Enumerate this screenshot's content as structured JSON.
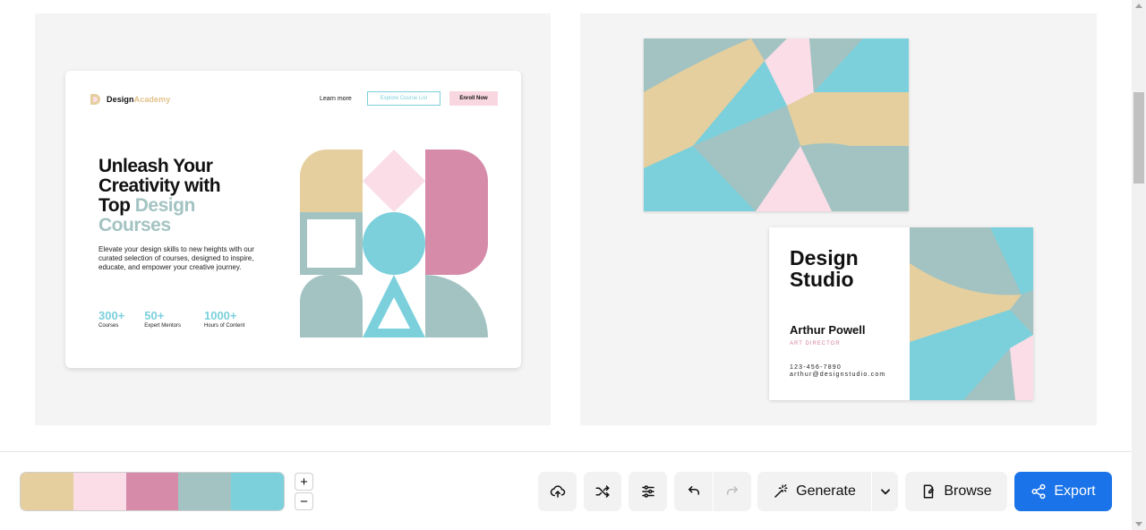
{
  "landing_page": {
    "logo_primary": "Design",
    "logo_accent": "Academy",
    "nav_learn_more": "Learn more",
    "nav_explore": "Explore Course List",
    "nav_enroll": "Enroll Now",
    "hero_line1": "Unleash Your",
    "hero_line2": "Creativity with",
    "hero_line3_dark": "Top ",
    "hero_line3_muted": "Design",
    "hero_line4_muted": "Courses",
    "description": "Elevate your design skills to new heights with our curated selection of courses, designed to inspire, educate, and empower your creative journey.",
    "stats": [
      {
        "value": "300+",
        "label": "Courses"
      },
      {
        "value": "50+",
        "label": "Expert Mentors"
      },
      {
        "value": "1000+",
        "label": "Hours of Content"
      }
    ]
  },
  "business_card": {
    "title_line1": "Design",
    "title_line2": "Studio",
    "name": "Arthur Powell",
    "role": "ART DIRECTOR",
    "phone": "123-456-7890",
    "email": "arthur@designstudio.com"
  },
  "palette": {
    "colors": [
      "#e5cf9e",
      "#fadde7",
      "#d68ba9",
      "#a3c3c2",
      "#7bd0dc"
    ]
  },
  "zoom": {
    "plus": "+",
    "minus": "−"
  },
  "toolbar": {
    "upload_icon": "cloud-upload-icon",
    "shuffle_icon": "shuffle-icon",
    "adjust_icon": "sliders-icon",
    "undo_icon": "undo-icon",
    "redo_icon": "redo-icon",
    "generate_label": "Generate",
    "browse_label": "Browse",
    "export_label": "Export"
  },
  "colors": {
    "accent": "#1a73e8",
    "sand": "#e5cf9e",
    "pink": "#fadde7",
    "rose": "#d68ba9",
    "sage": "#a3c3c2",
    "cyan": "#7bd0dc"
  }
}
